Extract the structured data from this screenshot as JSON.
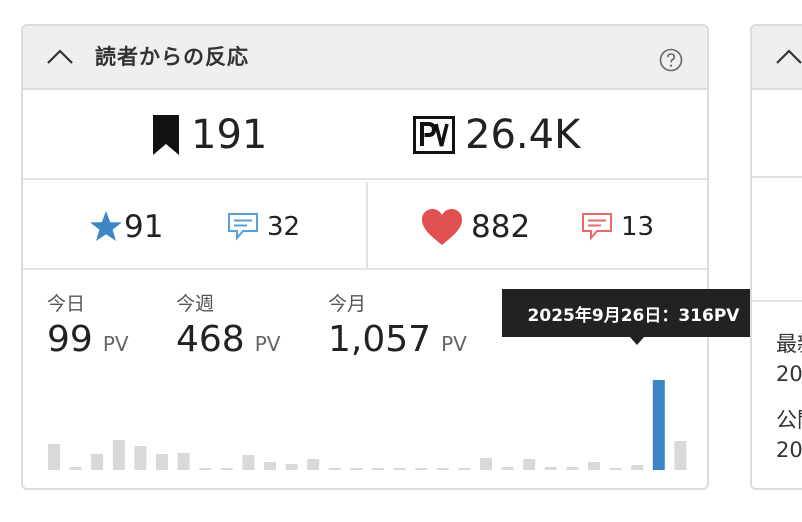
{
  "card": {
    "title": "読者からの反応",
    "bookmarks": "191",
    "pageviews": "26.4K",
    "stars": "91",
    "star_comments": "32",
    "likes": "882",
    "like_comments": "13"
  },
  "periods": [
    {
      "label": "今日",
      "value": "99",
      "unit": "PV"
    },
    {
      "label": "今週",
      "value": "468",
      "unit": "PV"
    },
    {
      "label": "今月",
      "value": "1,057",
      "unit": "PV"
    }
  ],
  "tooltip": {
    "text": "2025年9月26日：316PV"
  },
  "colors": {
    "accent_blue": "#3d85c6",
    "heart_red": "#e05050",
    "bar_gray": "#d9d9d9"
  },
  "chart_data": {
    "type": "bar",
    "values": [
      26,
      3,
      16,
      30,
      24,
      16,
      17,
      2,
      2,
      15,
      8,
      6,
      11,
      2,
      2,
      2,
      2,
      2,
      2,
      2,
      12,
      3,
      11,
      3,
      3,
      8,
      2,
      5,
      90,
      29
    ],
    "highlight_index": 28,
    "highlight_value": 316
  },
  "card2": {
    "line1": "最新",
    "line2": "20",
    "line3": "公開",
    "line4": "20"
  }
}
